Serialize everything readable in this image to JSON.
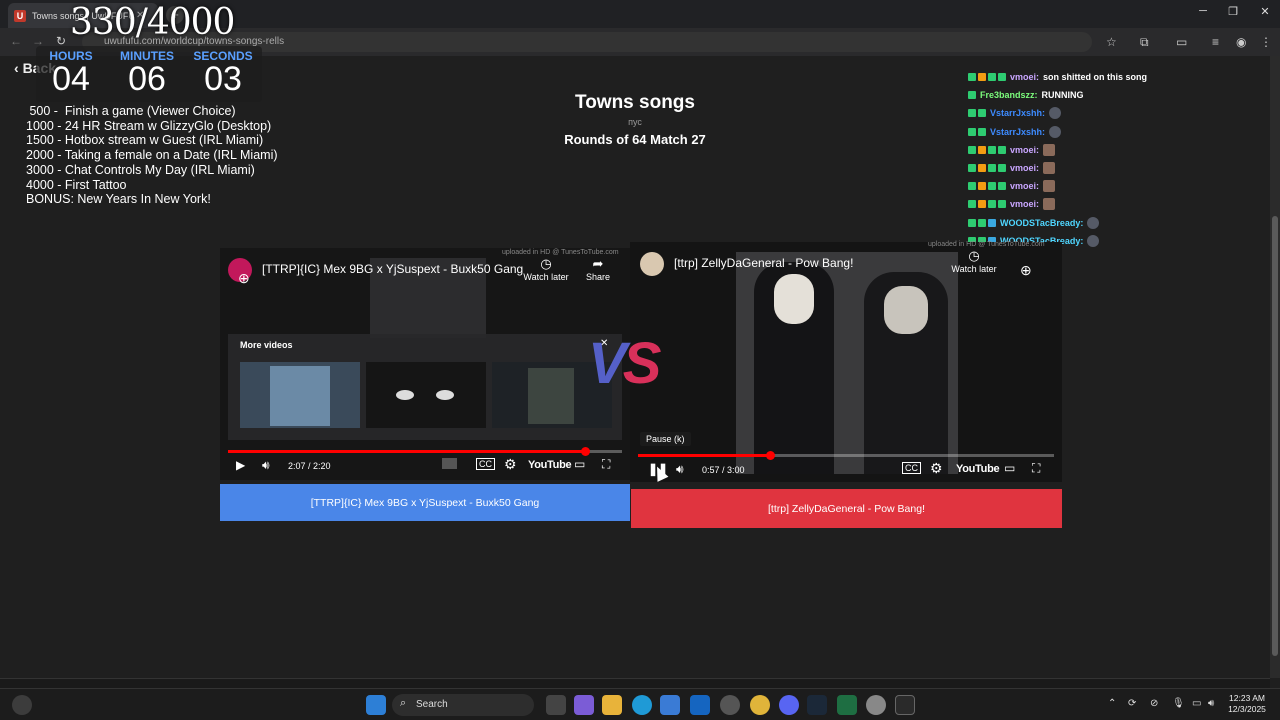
{
  "browser": {
    "tab_title": "Towns songs | UwUFUFU",
    "tab_favicon": "U",
    "url": "uwufufu.com/worldcup/towns-songs-rells",
    "new_tab_label": "+",
    "close_label": "✕"
  },
  "overlay": {
    "count": "330/4000",
    "timer": {
      "hours_label": "HOURS",
      "hours": "04",
      "minutes_label": "MINUTES",
      "minutes": "06",
      "seconds_label": "SECONDS",
      "seconds": "03"
    },
    "goals": [
      " 500 -  Finish a game (Viewer Choice)",
      "1000 - 24 HR Stream w GlizzyGlo (Desktop)",
      "1500 - Hotbox stream w Guest (IRL Miami)",
      "2000 - Taking a female on a Date (IRL Miami)",
      "3000 - Chat Controls My Day (IRL Miami)",
      "4000 - First Tattoo",
      "BONUS: New Years In New York!"
    ]
  },
  "page": {
    "back_label": "Back",
    "title": "Towns songs",
    "subtitle": "пус",
    "round": "Rounds of 64 Match 27",
    "vs_v": "V",
    "vs_s": "S"
  },
  "chat": [
    {
      "user": "vmoei:",
      "msg": "son shitted on this song",
      "color": "#c9a6ff",
      "badges": [
        "#2ecc71",
        "#f39c12",
        "#2ecc71",
        "#2ecc71"
      ],
      "emote": ""
    },
    {
      "user": "Fre3bandszz:",
      "msg": "RUNNING",
      "color": "#7cfc7c",
      "badges": [
        "#2ecc71"
      ],
      "emote": ""
    },
    {
      "user": "VstarrJxshh:",
      "msg": "",
      "color": "#3d8bff",
      "badges": [
        "#2ecc71",
        "#2ecc71"
      ],
      "emote": "dark"
    },
    {
      "user": "VstarrJxshh:",
      "msg": "",
      "color": "#3d8bff",
      "badges": [
        "#2ecc71",
        "#2ecc71"
      ],
      "emote": "dark"
    },
    {
      "user": "vmoei:",
      "msg": "",
      "color": "#c9a6ff",
      "badges": [
        "#2ecc71",
        "#f39c12",
        "#2ecc71",
        "#2ecc71"
      ],
      "emote": "face"
    },
    {
      "user": "vmoei:",
      "msg": "",
      "color": "#c9a6ff",
      "badges": [
        "#2ecc71",
        "#f39c12",
        "#2ecc71",
        "#2ecc71"
      ],
      "emote": "face"
    },
    {
      "user": "vmoei:",
      "msg": "",
      "color": "#c9a6ff",
      "badges": [
        "#2ecc71",
        "#f39c12",
        "#2ecc71",
        "#2ecc71"
      ],
      "emote": "face"
    },
    {
      "user": "vmoei:",
      "msg": "",
      "color": "#c9a6ff",
      "badges": [
        "#2ecc71",
        "#f39c12",
        "#2ecc71",
        "#2ecc71"
      ],
      "emote": "face"
    },
    {
      "user": "WOODSTacBready:",
      "msg": "",
      "color": "#4fd6ff",
      "badges": [
        "#2ecc71",
        "#2ecc71",
        "#3aa8e0"
      ],
      "emote": "dark"
    },
    {
      "user": "WOODSTacBready:",
      "msg": "",
      "color": "#4fd6ff",
      "badges": [
        "#2ecc71",
        "#2ecc71",
        "#3aa8e0"
      ],
      "emote": "dark"
    }
  ],
  "video_left": {
    "title": "[TTRP]{IC} Mex 9BG x YjSuspext - Buxk50 Gang",
    "watch_later": "Watch later",
    "share": "Share",
    "more_videos": "More videos",
    "time": "2:07 / 2:20",
    "progress": 0.907,
    "youtube": "YouTube",
    "watermark": "uploaded in HD @ TunesToTube.com",
    "choice_label": "[TTRP]{IC} Mex 9BG x YjSuspext - Buxk50 Gang",
    "choice_color": "#4a86e8"
  },
  "video_right": {
    "title": "[ttrp] ZellyDaGeneral - Pow Bang!",
    "watch_later": "Watch later",
    "pause_tooltip": "Pause (k)",
    "time": "0:57 / 3:00",
    "progress": 0.317,
    "youtube": "YouTube",
    "watermark": "uploaded in HD @ TunesToTube.com",
    "choice_label": "[ttrp] ZellyDaGeneral - Pow Bang!",
    "choice_color": "#e0343f"
  },
  "taskbar": {
    "search_label": "Search",
    "clock_time": "12:23 AM",
    "clock_date": "12/3/2025"
  }
}
